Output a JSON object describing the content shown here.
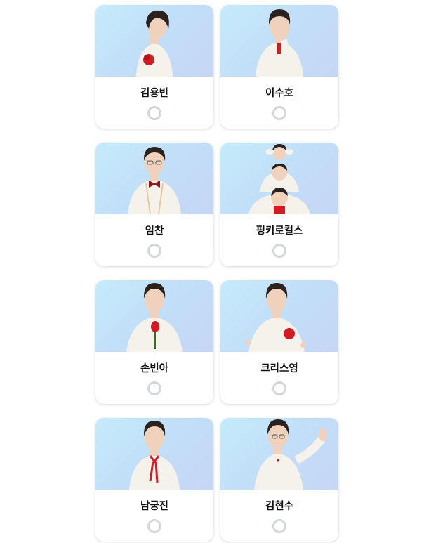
{
  "candidates": [
    {
      "name": "김용빈",
      "pose": "rose-chest"
    },
    {
      "name": "이수호",
      "pose": "shush"
    },
    {
      "name": "임찬",
      "pose": "bowtie"
    },
    {
      "name": "펑키로컬스",
      "pose": "group"
    },
    {
      "name": "손빈아",
      "pose": "rose-hand"
    },
    {
      "name": "크리스영",
      "pose": "flower-hands"
    },
    {
      "name": "남궁진",
      "pose": "red-tie"
    },
    {
      "name": "김현수",
      "pose": "wave"
    }
  ],
  "colors": {
    "suit": "#f5f2ec",
    "hair": "#2b2220",
    "skin": "#f0d2bc",
    "accent_red": "#d31b24",
    "radio_border": "#d3d6db"
  }
}
